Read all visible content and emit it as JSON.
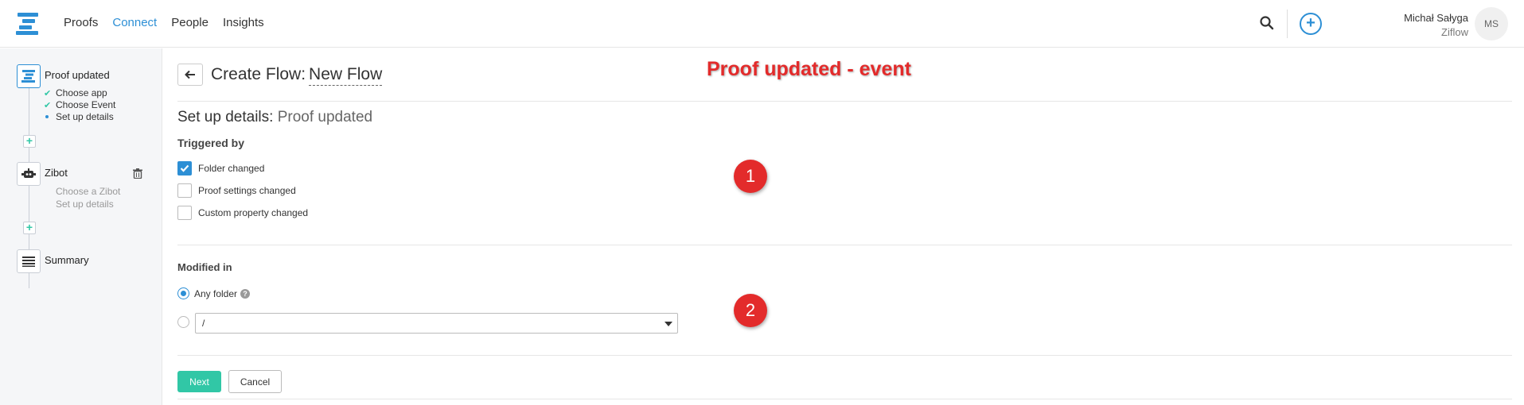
{
  "nav": {
    "items": [
      {
        "label": "Proofs",
        "active": false
      },
      {
        "label": "Connect",
        "active": true
      },
      {
        "label": "People",
        "active": false
      },
      {
        "label": "Insights",
        "active": false
      }
    ]
  },
  "user": {
    "name": "Michał Sałyga",
    "org": "Ziflow",
    "initials": "MS"
  },
  "sidebar": {
    "steps": [
      {
        "title": "Proof updated",
        "icon": "ziflow-logo-icon",
        "subs": [
          "Choose app",
          "Choose Event",
          "Set up details"
        ]
      },
      {
        "title": "Zibot",
        "icon": "robot-icon",
        "subs": [
          "Choose a Zibot",
          "Set up details"
        ]
      },
      {
        "title": "Summary",
        "icon": "list-icon"
      }
    ]
  },
  "header": {
    "prefix": "Create Flow:",
    "flow_name": "New Flow"
  },
  "annotation": {
    "title": "Proof updated - event",
    "badge1": "1",
    "badge2": "2"
  },
  "details": {
    "heading": "Set up details:",
    "heading_sub": "Proof updated",
    "triggered_by_label": "Triggered by",
    "options": [
      {
        "label": "Folder changed",
        "checked": true
      },
      {
        "label": "Proof settings changed",
        "checked": false
      },
      {
        "label": "Custom property changed",
        "checked": false
      }
    ],
    "modified_in_label": "Modified in",
    "any_folder_label": "Any folder",
    "folder_select_value": "/"
  },
  "actions": {
    "next_label": "Next",
    "cancel_label": "Cancel"
  },
  "colors": {
    "accent": "#2d8fd5",
    "teal": "#31c7a6",
    "annotation_red": "#e32b2b"
  }
}
